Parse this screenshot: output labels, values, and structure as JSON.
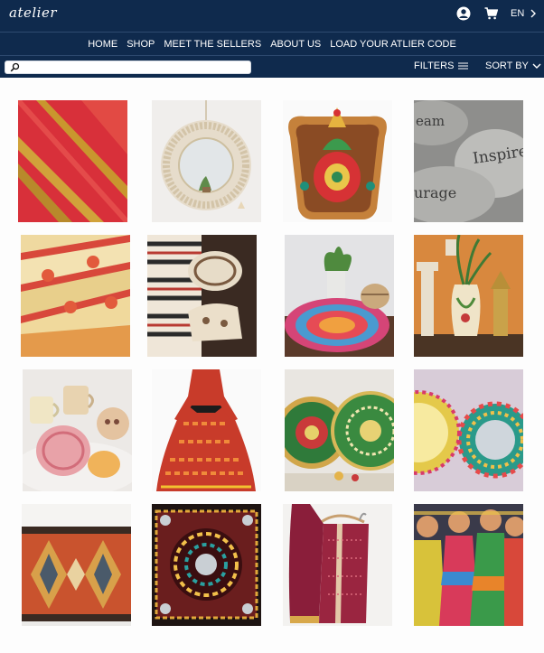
{
  "brand": {
    "logo": "atelier"
  },
  "header": {
    "language": "EN",
    "icons": {
      "account": "user-circle-icon",
      "cart": "shopping-cart-icon",
      "language": "chevron-right-icon"
    }
  },
  "nav": {
    "items": [
      {
        "label": "HOME"
      },
      {
        "label": "SHOP"
      },
      {
        "label": "MEET THE SELLERS"
      },
      {
        "label": "ABOUT US"
      },
      {
        "label": "LOAD YOUR ATLIER CODE"
      }
    ]
  },
  "toolbar": {
    "search_placeholder": "",
    "filters_label": "FILTERS",
    "sort_label": "SORT BY"
  },
  "colors": {
    "header_bg": "#0f2a4d",
    "page_bg": "#fdfdfd"
  },
  "products": [
    {
      "image": "red-silk-saree-photo"
    },
    {
      "image": "macrame-round-mirror-photo"
    },
    {
      "image": "painted-kalash-wall-decor-photo"
    },
    {
      "image": "inspirational-word-stones-photo"
    },
    {
      "image": "assam-mekhela-textiles-photo"
    },
    {
      "image": "wooden-block-print-stamps-photo"
    },
    {
      "image": "braided-round-rug-photo"
    },
    {
      "image": "painted-vases-candle-stands-photo"
    },
    {
      "image": "hand-painted-ceramic-cups-plate-photo"
    },
    {
      "image": "ikat-print-dress-photo"
    },
    {
      "image": "embroidered-mirror-plates-photo"
    },
    {
      "image": "beaded-decorative-mirrors-photo"
    },
    {
      "image": "kilim-woven-rug-photo"
    },
    {
      "image": "kutch-mirror-embroidery-photo"
    },
    {
      "image": "maroon-printed-saree-photo"
    },
    {
      "image": "kondapalli-wooden-dolls-photo"
    }
  ]
}
